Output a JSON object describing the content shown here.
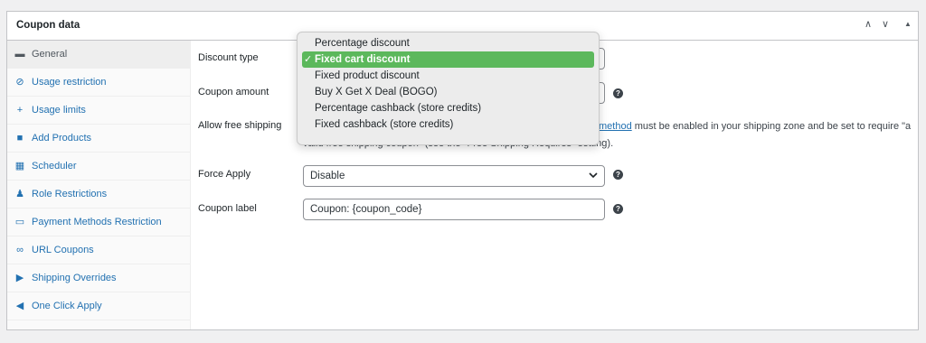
{
  "panel": {
    "title": "Coupon data",
    "controls": {
      "up": "∧",
      "down": "∨",
      "toggle": "▲"
    }
  },
  "sidebar": {
    "items": [
      {
        "label": "General",
        "icon": "ticket-icon",
        "glyph": "▬",
        "active": true
      },
      {
        "label": "Usage restriction",
        "icon": "block-icon",
        "glyph": "⊘"
      },
      {
        "label": "Usage limits",
        "icon": "plus-icon",
        "glyph": "+"
      },
      {
        "label": "Add Products",
        "icon": "bag-icon",
        "glyph": "■"
      },
      {
        "label": "Scheduler",
        "icon": "calendar-icon",
        "glyph": "▦"
      },
      {
        "label": "Role Restrictions",
        "icon": "user-icon",
        "glyph": "♟"
      },
      {
        "label": "Payment Methods Restriction",
        "icon": "card-icon",
        "glyph": "▭"
      },
      {
        "label": "URL Coupons",
        "icon": "link-icon",
        "glyph": "∞"
      },
      {
        "label": "Shipping Overrides",
        "icon": "truck-icon",
        "glyph": "▶"
      },
      {
        "label": "One Click Apply",
        "icon": "megaphone-icon",
        "glyph": "◀"
      }
    ]
  },
  "fields": {
    "discount_type": {
      "label": "Discount type"
    },
    "coupon_amount": {
      "label": "Coupon amount",
      "help": "?"
    },
    "free_shipping": {
      "label": "Allow free shipping",
      "link_text": "method",
      "desc_1": " must be enabled in your shipping zone and be set to require \"a",
      "desc_2": "valid free shipping coupon\" (see the \"Free Shipping Requires\" setting)."
    },
    "force_apply": {
      "label": "Force Apply",
      "value": "Disable",
      "help": "?"
    },
    "coupon_label": {
      "label": "Coupon label",
      "value": "Coupon: {coupon_code}",
      "help": "?"
    }
  },
  "dropdown": {
    "options": [
      "Percentage discount",
      "Fixed cart discount",
      "Fixed product discount",
      "Buy X Get X Deal (BOGO)",
      "Percentage cashback (store credits)",
      "Fixed cashback (store credits)"
    ],
    "selected": "Fixed cart discount",
    "check": "✓",
    "highlight_color": "#5cb85c"
  },
  "colors": {
    "link": "#2271b1",
    "border": "#c3c4c7"
  }
}
